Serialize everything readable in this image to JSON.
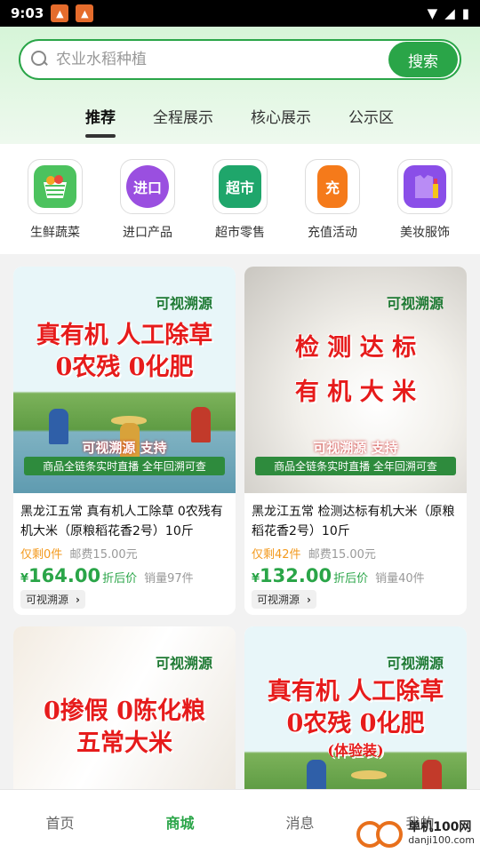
{
  "status_bar": {
    "time": "9:03"
  },
  "search": {
    "placeholder": "农业水稻种植",
    "button_label": "搜索"
  },
  "tabs": [
    {
      "label": "推荐",
      "active": true
    },
    {
      "label": "全程展示",
      "active": false
    },
    {
      "label": "核心展示",
      "active": false
    },
    {
      "label": "公示区",
      "active": false
    }
  ],
  "categories": [
    {
      "label": "生鲜蔬菜",
      "icon": "basket-icon",
      "color": "#4cc25e"
    },
    {
      "label": "进口产品",
      "icon_text": "进口",
      "icon": "import-planet-icon",
      "color": "#9a4fe0"
    },
    {
      "label": "超市零售",
      "icon_text": "超市",
      "icon": "supermarket-icon",
      "color": "#1fa66b"
    },
    {
      "label": "充值活动",
      "icon_text": "充",
      "icon": "recharge-phone-icon",
      "color": "#f57a1a"
    },
    {
      "label": "美妆服饰",
      "icon": "shirt-lipstick-icon",
      "color": "#8a4ee8"
    }
  ],
  "products": [
    {
      "brand": "可视溯源",
      "headline_1": "真有机 人工除草",
      "headline_2": "0农残 0化肥",
      "support": "可视溯源 支持",
      "subline": "商品全链条实时直播 全年回溯可查",
      "title": "黑龙江五常 真有机人工除草 0农残有机大米（原粮稻花香2号）10斤",
      "remain": "仅剩0件",
      "shipping": "邮费15.00元",
      "currency": "¥",
      "price": "164.00",
      "price_label": "折后价",
      "sales": "销量97件",
      "trace_label": "可视溯源"
    },
    {
      "brand": "可视溯源",
      "headline_1": "检 测 达 标",
      "headline_2": "有 机 大 米",
      "support": "可视溯源 支持",
      "subline": "商品全链条实时直播 全年回溯可查",
      "title": "黑龙江五常 检测达标有机大米（原粮稻花香2号）10斤",
      "remain": "仅剩42件",
      "shipping": "邮费15.00元",
      "currency": "¥",
      "price": "132.00",
      "price_label": "折后价",
      "sales": "销量40件",
      "trace_label": "可视溯源"
    },
    {
      "brand": "可视溯源",
      "headline_1": "0掺假 0陈化粮",
      "headline_2": "五常大米"
    },
    {
      "brand": "可视溯源",
      "headline_1": "真有机 人工除草",
      "headline_2": "0农残 0化肥",
      "tag": "(体验装)"
    }
  ],
  "bottom_nav": [
    {
      "label": "首页",
      "active": false
    },
    {
      "label": "商城",
      "active": true
    },
    {
      "label": "消息",
      "active": false
    },
    {
      "label": "我的",
      "active": false
    }
  ],
  "watermark": {
    "name": "单机100网",
    "url": "danji100.com"
  }
}
